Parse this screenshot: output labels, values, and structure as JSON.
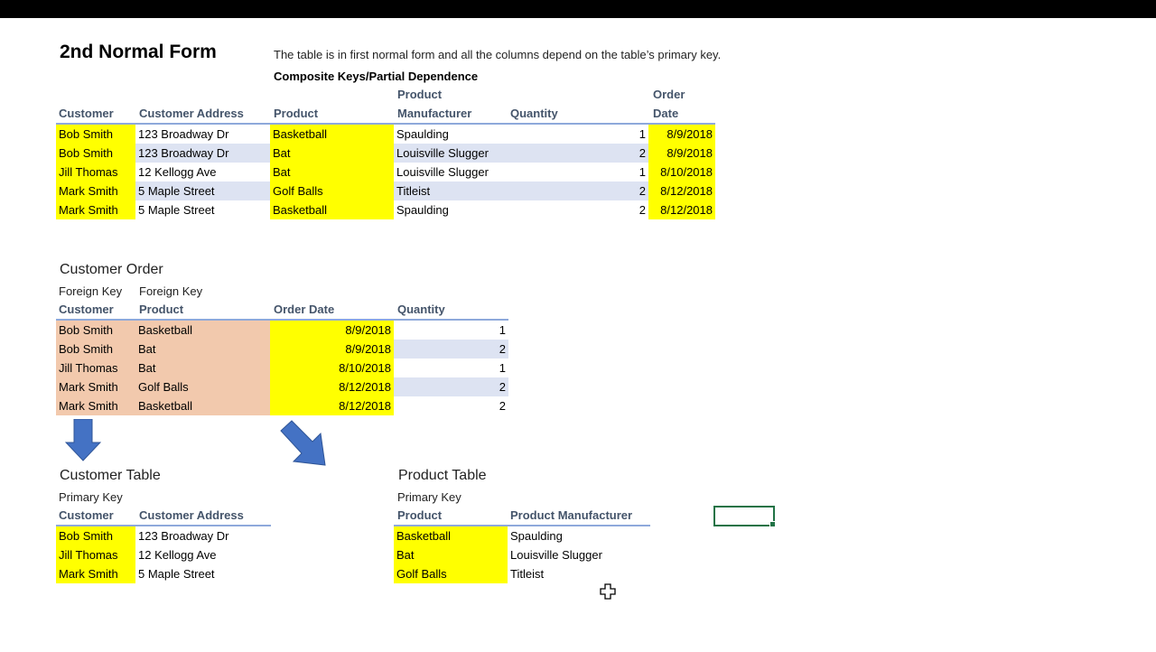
{
  "title": "2nd Normal Form",
  "intro": "The table is in first normal form and all the columns depend on the table’s primary key.",
  "subtitle": "Composite Keys/Partial Dependence",
  "colors": {
    "key_highlight": "#ffff00",
    "foreign_key_highlight": "#f2c9ad",
    "band": "#dde3f2",
    "header_text": "#44546a",
    "header_rule": "#8ea9db",
    "selection": "#217346",
    "arrow": "#4472c4"
  },
  "main_table": {
    "headers": {
      "customer": "Customer",
      "address": "Customer Address",
      "product": "Product",
      "manufacturer_1": "Product",
      "manufacturer_2": "Manufacturer",
      "quantity": "Quantity",
      "date_1": "Order",
      "date_2": "Date"
    },
    "rows": [
      {
        "customer": "Bob Smith",
        "address": "123 Broadway Dr",
        "product": "Basketball",
        "manufacturer": "Spaulding",
        "quantity": "1",
        "date": "8/9/2018"
      },
      {
        "customer": "Bob Smith",
        "address": "123 Broadway Dr",
        "product": "Bat",
        "manufacturer": "Louisville Slugger",
        "quantity": "2",
        "date": "8/9/2018"
      },
      {
        "customer": "Jill Thomas",
        "address": "12 Kellogg Ave",
        "product": "Bat",
        "manufacturer": "Louisville Slugger",
        "quantity": "1",
        "date": "8/10/2018"
      },
      {
        "customer": "Mark Smith",
        "address": "5 Maple Street",
        "product": "Golf Balls",
        "manufacturer": "Titleist",
        "quantity": "2",
        "date": "8/12/2018"
      },
      {
        "customer": "Mark Smith",
        "address": "5 Maple Street",
        "product": "Basketball",
        "manufacturer": "Spaulding",
        "quantity": "2",
        "date": "8/12/2018"
      }
    ]
  },
  "customer_order": {
    "title": "Customer Order",
    "fk_label_1": "Foreign Key",
    "fk_label_2": "Foreign Key",
    "headers": {
      "customer": "Customer",
      "product": "Product",
      "date": "Order Date",
      "quantity": "Quantity"
    },
    "rows": [
      {
        "customer": "Bob Smith",
        "product": "Basketball",
        "date": "8/9/2018",
        "quantity": "1"
      },
      {
        "customer": "Bob Smith",
        "product": "Bat",
        "date": "8/9/2018",
        "quantity": "2"
      },
      {
        "customer": "Jill Thomas",
        "product": "Bat",
        "date": "8/10/2018",
        "quantity": "1"
      },
      {
        "customer": "Mark Smith",
        "product": "Golf Balls",
        "date": "8/12/2018",
        "quantity": "2"
      },
      {
        "customer": "Mark Smith",
        "product": "Basketball",
        "date": "8/12/2018",
        "quantity": "2"
      }
    ]
  },
  "customer_table": {
    "title": "Customer Table",
    "pk_label": "Primary Key",
    "headers": {
      "customer": "Customer",
      "address": "Customer Address"
    },
    "rows": [
      {
        "customer": "Bob Smith",
        "address": "123 Broadway Dr"
      },
      {
        "customer": "Jill Thomas",
        "address": "12 Kellogg Ave"
      },
      {
        "customer": "Mark Smith",
        "address": "5 Maple Street"
      }
    ]
  },
  "product_table": {
    "title": "Product Table",
    "pk_label": "Primary Key",
    "headers": {
      "product": "Product",
      "manufacturer": "Product Manufacturer"
    },
    "rows": [
      {
        "product": "Basketball",
        "manufacturer": "Spaulding"
      },
      {
        "product": "Bat",
        "manufacturer": "Louisville Slugger"
      },
      {
        "product": "Golf Balls",
        "manufacturer": "Titleist"
      }
    ]
  },
  "icons": {
    "arrow_down": "arrow-down-icon",
    "arrow_diagonal": "arrow-down-right-icon",
    "cursor": "cell-cursor-icon"
  }
}
